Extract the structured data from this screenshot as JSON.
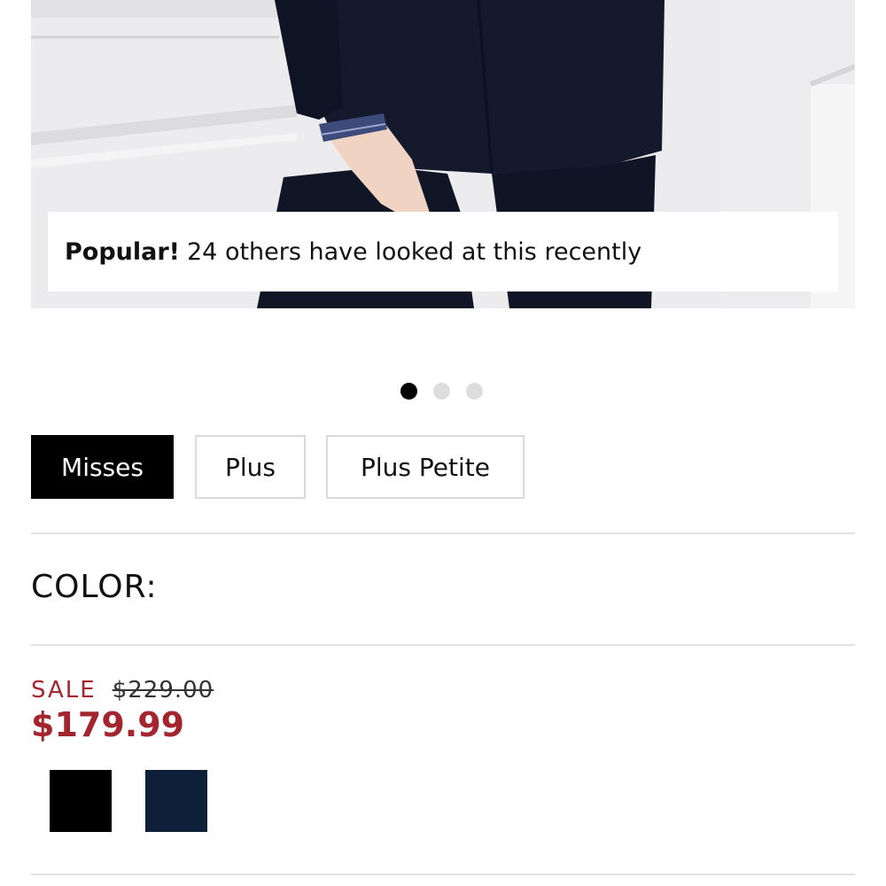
{
  "hero": {
    "banner": {
      "strong": "Popular!",
      "text": "24 others have looked at this recently"
    }
  },
  "carousel": {
    "dot_count": 3,
    "active_index": 0
  },
  "size_tabs": [
    {
      "label": "Misses",
      "active": true
    },
    {
      "label": "Plus",
      "active": false
    },
    {
      "label": "Plus Petite",
      "active": false
    }
  ],
  "color": {
    "label": "COLOR:"
  },
  "pricing": {
    "sale_label": "SALE",
    "original_price": "$229.00",
    "sale_price": "$179.99"
  },
  "swatches": [
    {
      "icon": "color-swatch",
      "color": "#000000"
    },
    {
      "icon": "color-swatch",
      "color": "#0e2038"
    }
  ],
  "colors": {
    "accent": "#a3262f",
    "selected_tab_bg": "#000000",
    "divider": "#e2e2e2"
  }
}
